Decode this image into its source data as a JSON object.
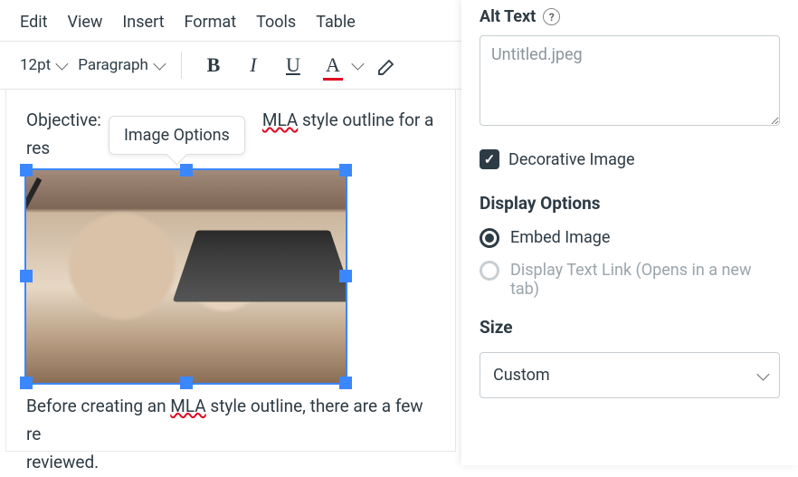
{
  "menubar": {
    "items": [
      "Edit",
      "View",
      "Insert",
      "Format",
      "Tools",
      "Table"
    ]
  },
  "toolbar": {
    "font_size": "12pt",
    "block_format": "Paragraph"
  },
  "tooltip": {
    "text": "Image Options"
  },
  "content": {
    "para1_prefix": "Objective: ",
    "para1_squiggle": "MLA",
    "para1_suffix": " style outline for a res",
    "para2_prefix": "Before creating an ",
    "para2_squiggle": "MLA",
    "para2_suffix": " style outline, there are a few re",
    "para3": "reviewed."
  },
  "panel": {
    "alt_label": "Alt Text",
    "alt_placeholder": "Untitled.jpeg",
    "decorative_label": "Decorative Image",
    "decorative_checked": true,
    "display_options_title": "Display Options",
    "embed_label": "Embed Image",
    "link_label": "Display Text Link (Opens in a new tab)",
    "size_label": "Size",
    "size_value": "Custom"
  }
}
